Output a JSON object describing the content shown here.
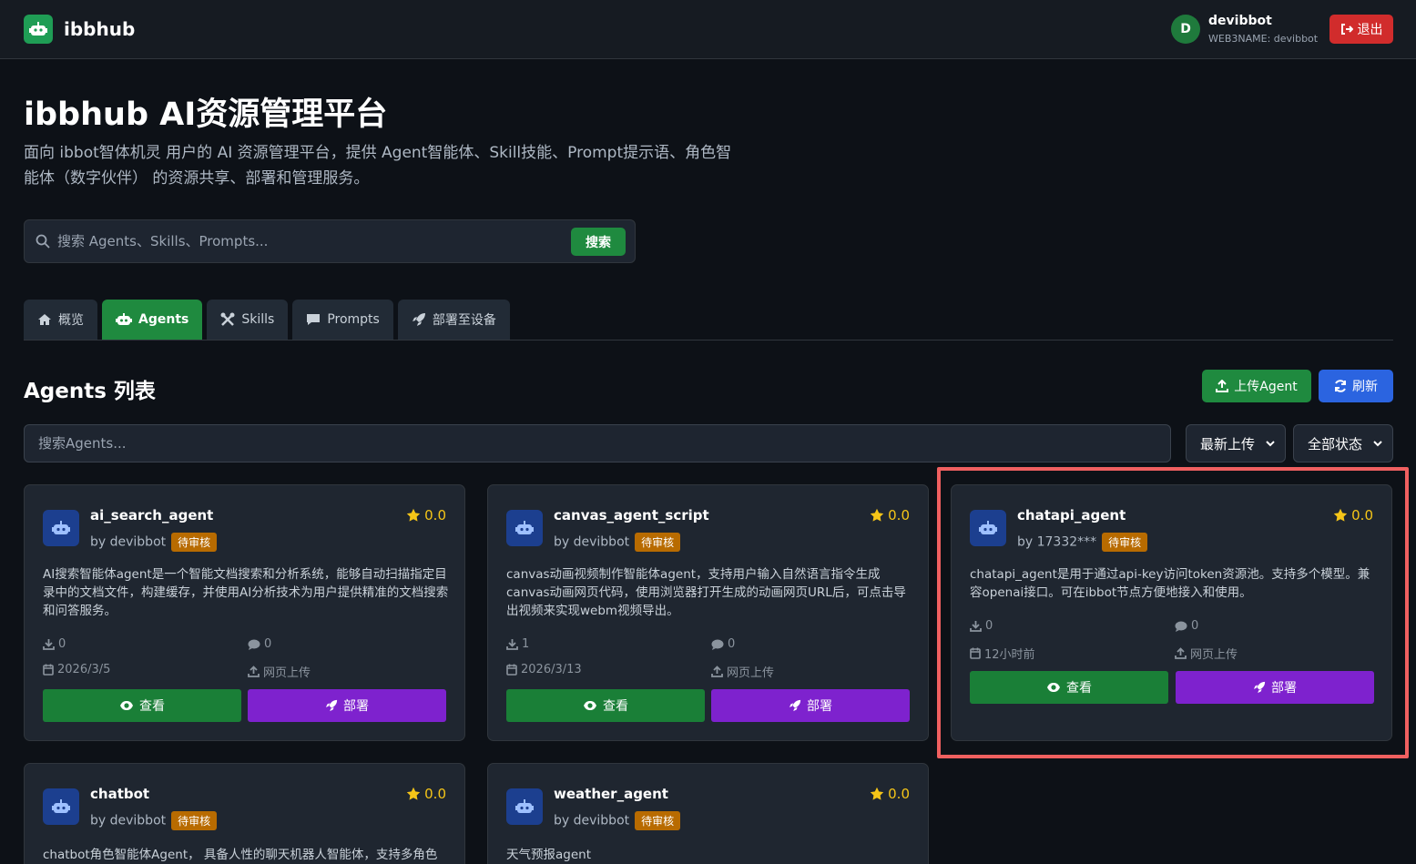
{
  "header": {
    "brand": "ibbhub",
    "user_initial": "D",
    "user_name": "devibbot",
    "user_sub": "WEB3NAME: devibbot",
    "logout_label": "退出"
  },
  "hero": {
    "title": "ibbhub AI资源管理平台",
    "description": "面向 ibbot智体机灵 用户的 AI 资源管理平台，提供 Agent智能体、Skill技能、Prompt提示语、角色智能体（数字伙伴） 的资源共享、部署和管理服务。"
  },
  "search": {
    "placeholder": "搜索 Agents、Skills、Prompts...",
    "button": "搜索"
  },
  "tabs": [
    {
      "label": "概览",
      "icon": "home-icon"
    },
    {
      "label": "Agents",
      "icon": "robot-icon"
    },
    {
      "label": "Skills",
      "icon": "tools-icon"
    },
    {
      "label": "Prompts",
      "icon": "comment-icon"
    },
    {
      "label": "部署至设备",
      "icon": "rocket-icon"
    }
  ],
  "section": {
    "title": "Agents 列表",
    "upload_label": "上传Agent",
    "refresh_label": "刷新",
    "filter_placeholder": "搜索Agents...",
    "sort_value": "最新上传",
    "status_value": "全部状态"
  },
  "colors": {
    "accent_green": "#1f8a3f",
    "deploy_purple": "#7e22ce",
    "refresh_blue": "#2b64e0",
    "badge_orange": "#b86b00",
    "highlight_red": "#f06060"
  },
  "cards": [
    {
      "name": "ai_search_agent",
      "author": "by devibbot",
      "badge": "待审核",
      "rating": "0.0",
      "description": "AI搜索智能体agent是一个智能文档搜索和分析系统，能够自动扫描指定目录中的文档文件，构建缓存，并使用AI分析技术为用户提供精准的文档搜索和问答服务。",
      "downloads": "0",
      "comments": "0",
      "date": "2026/3/5",
      "source": "网页上传",
      "view": "查看",
      "deploy": "部署"
    },
    {
      "name": "canvas_agent_script",
      "author": "by devibbot",
      "badge": "待审核",
      "rating": "0.0",
      "description": "canvas动画视频制作智能体agent，支持用户输入自然语言指令生成canvas动画网页代码，使用浏览器打开生成的动画网页URL后，可点击导出视频来实现webm视频导出。",
      "downloads": "1",
      "comments": "0",
      "date": "2026/3/13",
      "source": "网页上传",
      "view": "查看",
      "deploy": "部署"
    },
    {
      "name": "chatapi_agent",
      "author": "by 17332***",
      "badge": "待审核",
      "rating": "0.0",
      "description": "chatapi_agent是用于通过api-key访问token资源池。支持多个模型。兼容openai接口。可在ibbot节点方便地接入和使用。",
      "downloads": "0",
      "comments": "0",
      "date": "12小时前",
      "source": "网页上传",
      "view": "查看",
      "deploy": "部署"
    },
    {
      "name": "chatbot",
      "author": "by devibbot",
      "badge": "待审核",
      "rating": "0.0",
      "description": "chatbot角色智能体Agent， 具备人性的聊天机器人智能体，支持多角色"
    },
    {
      "name": "weather_agent",
      "author": "by devibbot",
      "badge": "待审核",
      "rating": "0.0",
      "description": "天气预报agent"
    }
  ]
}
